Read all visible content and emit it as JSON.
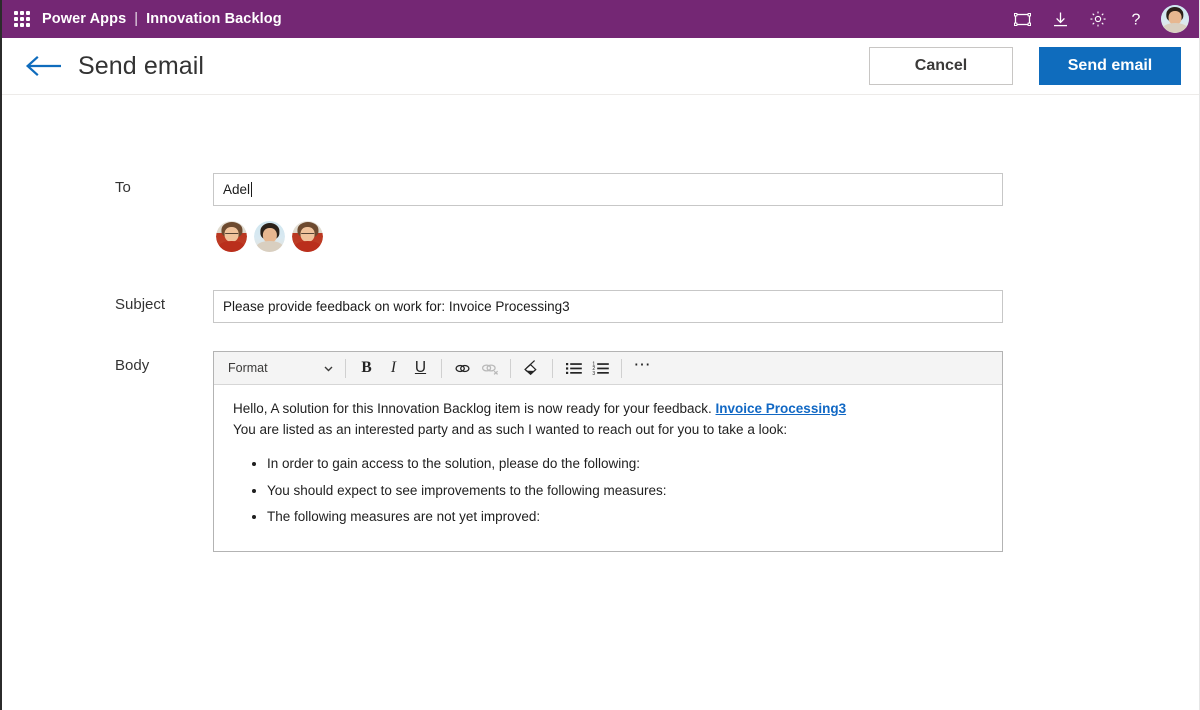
{
  "suitebar": {
    "waffle_label": "app-launcher",
    "app_name": "Power Apps",
    "separator": "|",
    "environment": "Innovation Backlog",
    "icons": [
      {
        "name": "fit-to-screen-icon",
        "title": "Fit to screen"
      },
      {
        "name": "download-icon",
        "title": "Download"
      },
      {
        "name": "gear-icon",
        "title": "Settings"
      },
      {
        "name": "help-icon",
        "title": "Help",
        "glyph": "?"
      }
    ],
    "account_label": "Account manager"
  },
  "commandbar": {
    "back_label": "Back",
    "title": "Send email",
    "cancel_label": "Cancel",
    "send_label": "Send email"
  },
  "form": {
    "to": {
      "label": "To",
      "value": "Adel",
      "placeholder": "",
      "recipients": [
        {
          "name": "recipient-avatar-1",
          "style": "red"
        },
        {
          "name": "recipient-avatar-2",
          "style": "blue"
        },
        {
          "name": "recipient-avatar-3",
          "style": "red"
        }
      ]
    },
    "subject": {
      "label": "Subject",
      "value": "Please provide feedback on work for: Invoice Processing3",
      "placeholder": ""
    },
    "body": {
      "label": "Body",
      "toolbar": {
        "format_label": "Format",
        "chevron": "▾",
        "bold": "B",
        "italic": "I",
        "underline": "U",
        "link_title": "Insert link",
        "unlink_title": "Remove link",
        "highlight_title": "Format painter",
        "bullet_list_title": "Bulleted list",
        "numbered_list_title": "Numbered list",
        "more": "⋯"
      },
      "content": {
        "line1_prefix": "Hello, A solution for this Innovation Backlog item is now ready for your feedback. ",
        "line1_link": "Invoice Processing3",
        "line2": "You are listed as an interested party and as such I wanted to reach out for you to take a look:",
        "bullets": [
          "In order to gain access to the solution, please do the following:",
          "You should expect to see improvements to the following measures:",
          "The following measures are not yet improved:"
        ]
      }
    }
  },
  "colors": {
    "suitebar_purple": "#742774",
    "primary_blue": "#0f6cbd",
    "link_blue": "#1168c4",
    "back_arrow_blue": "#0f6cbd",
    "toolbar_grey": "#f4f4f4",
    "border_grey": "#c7c7c7"
  }
}
